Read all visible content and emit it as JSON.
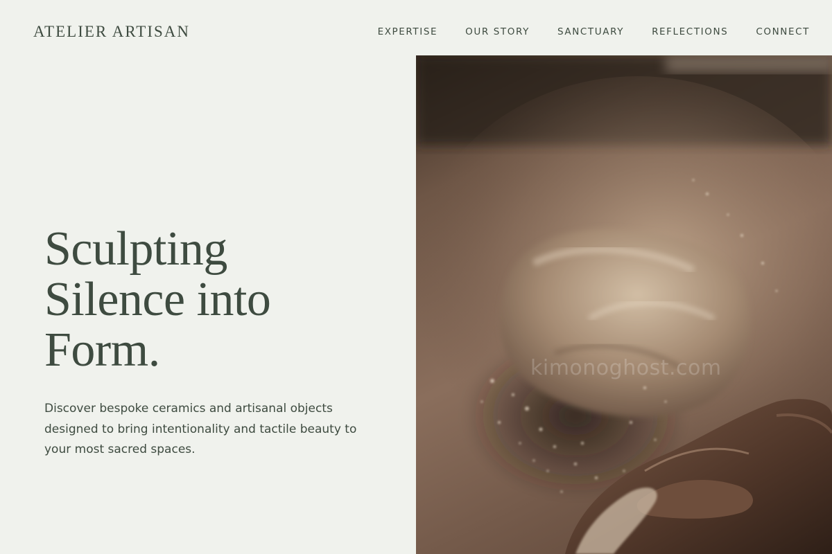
{
  "brand": {
    "name": "ATELIER ARTISAN"
  },
  "nav": {
    "items": [
      {
        "label": "EXPERTISE"
      },
      {
        "label": "OUR STORY"
      },
      {
        "label": "SANCTUARY"
      },
      {
        "label": "REFLECTIONS"
      },
      {
        "label": "CONNECT"
      }
    ]
  },
  "hero": {
    "title_lines": [
      "Sculpting",
      "Silence into",
      "Form."
    ],
    "subtitle": "Discover bespoke ceramics and artisanal objects designed to bring intentionality and tactile beauty to your most sacred spaces.",
    "image": {
      "subject": "hand kneading clay with flour dust",
      "watermark": "kimonoghost.com"
    }
  },
  "colors": {
    "background": "#f0f2ed",
    "text": "#3e4b40"
  }
}
